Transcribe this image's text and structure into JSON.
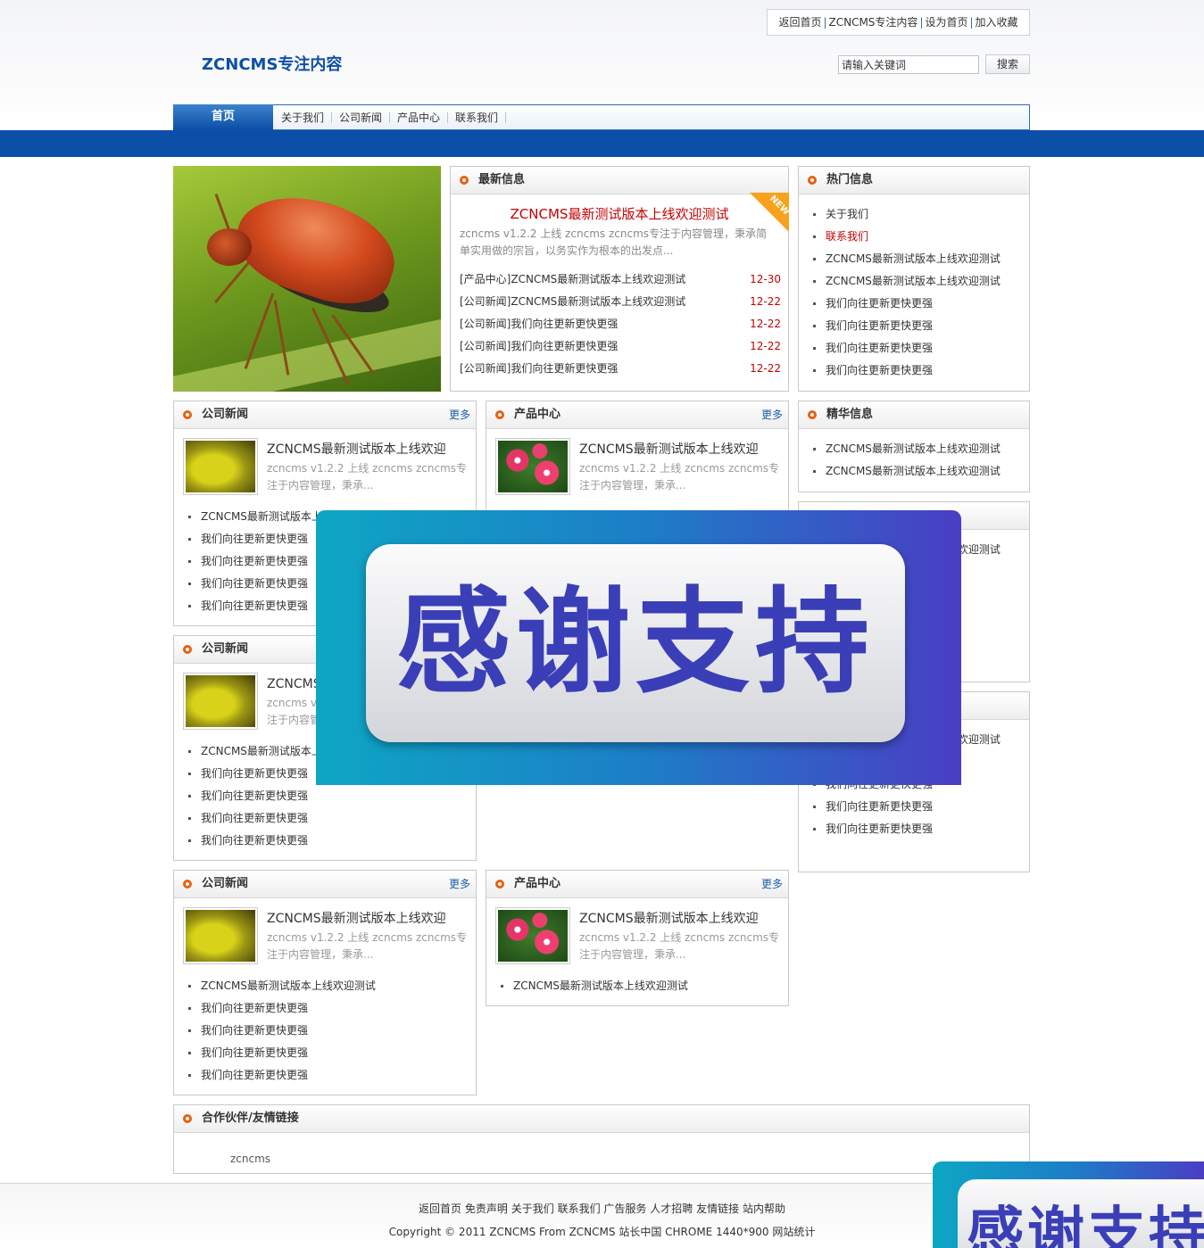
{
  "header": {
    "top_links": [
      "返回首页",
      "ZCNCMS专注内容",
      "设为首页",
      "加入收藏"
    ],
    "logo": "ZCNCMS专注内容",
    "search_placeholder": "请输入关键词",
    "search_button": "搜索"
  },
  "nav": {
    "home": "首页",
    "items": [
      "关于我们",
      "公司新闻",
      "产品中心",
      "联系我们"
    ]
  },
  "latest": {
    "title": "最新信息",
    "badge": "NEW",
    "headline": "ZCNCMS最新测试版本上线欢迎测试",
    "desc": "zcncms v1.2.2 上线 zcncms zcncms专注于内容管理，秉承简单实用做的宗旨，以务实作为根本的出发点...",
    "rows": [
      {
        "cat": "[产品中心]",
        "text": "ZCNCMS最新测试版本上线欢迎测试",
        "date": "12-30"
      },
      {
        "cat": "[公司新闻]",
        "text": "ZCNCMS最新测试版本上线欢迎测试",
        "date": "12-22"
      },
      {
        "cat": "[公司新闻]",
        "text": "我们向往更新更快更强",
        "date": "12-22"
      },
      {
        "cat": "[公司新闻]",
        "text": "我们向往更新更快更强",
        "date": "12-22"
      },
      {
        "cat": "[公司新闻]",
        "text": "我们向往更新更快更强",
        "date": "12-22"
      }
    ]
  },
  "hot": {
    "title": "热门信息",
    "items": [
      "关于我们",
      "联系我们",
      "ZCNCMS最新测试版本上线欢迎测试",
      "ZCNCMS最新测试版本上线欢迎测试",
      "我们向往更新更快更强",
      "我们向往更新更快更强",
      "我们向往更新更快更强",
      "我们向往更新更快更强"
    ]
  },
  "essence": {
    "title": "精华信息",
    "items": [
      "ZCNCMS最新测试版本上线欢迎测试",
      "ZCNCMS最新测试版本上线欢迎测试"
    ]
  },
  "side_box": {
    "item": "ZCNCMS最新测试版本上线欢迎测试"
  },
  "side_box2": {
    "items": [
      "ZCNCMS最新测试版本上线欢迎测试",
      "我们向往更新更快更强",
      "我们向往更新更快更强",
      "我们向往更新更快更强",
      "我们向往更新更快更强"
    ]
  },
  "more": "更多",
  "company_news": {
    "title": "公司新闻",
    "feature_title": "ZCNCMS最新测试版本上线欢迎",
    "feature_desc": "zcncms v1.2.2 上线 zcncms zcncms专注于内容管理，秉承...",
    "items": [
      "ZCNCMS最新测试版本上线欢迎测试",
      "我们向往更新更快更强",
      "我们向往更新更快更强",
      "我们向往更新更快更强",
      "我们向往更新更快更强"
    ]
  },
  "product_center": {
    "title": "产品中心",
    "feature_title": "ZCNCMS最新测试版本上线欢迎",
    "feature_desc": "zcncms v1.2.2 上线 zcncms zcncms专注于内容管理，秉承...",
    "items": [
      "ZCNCMS最新测试版本上线欢迎测试"
    ]
  },
  "overlay_text": "感谢支持",
  "links": {
    "title": "合作伙伴/友情链接",
    "items": [
      "zcncms"
    ]
  },
  "footer": {
    "links": [
      "返回首页",
      "免责声明",
      "关于我们",
      "联系我们",
      "广告服务",
      "人才招聘",
      "友情链接",
      "站内帮助"
    ],
    "copyright": "Copyright © 2011 ZCNCMS From ZCNCMS 站长中国 CHROME 1440*900 网站统计"
  },
  "colors": {
    "brand_blue": "#0b4fa6",
    "accent_red": "#c40000",
    "bullet_orange": "#e8600e"
  }
}
